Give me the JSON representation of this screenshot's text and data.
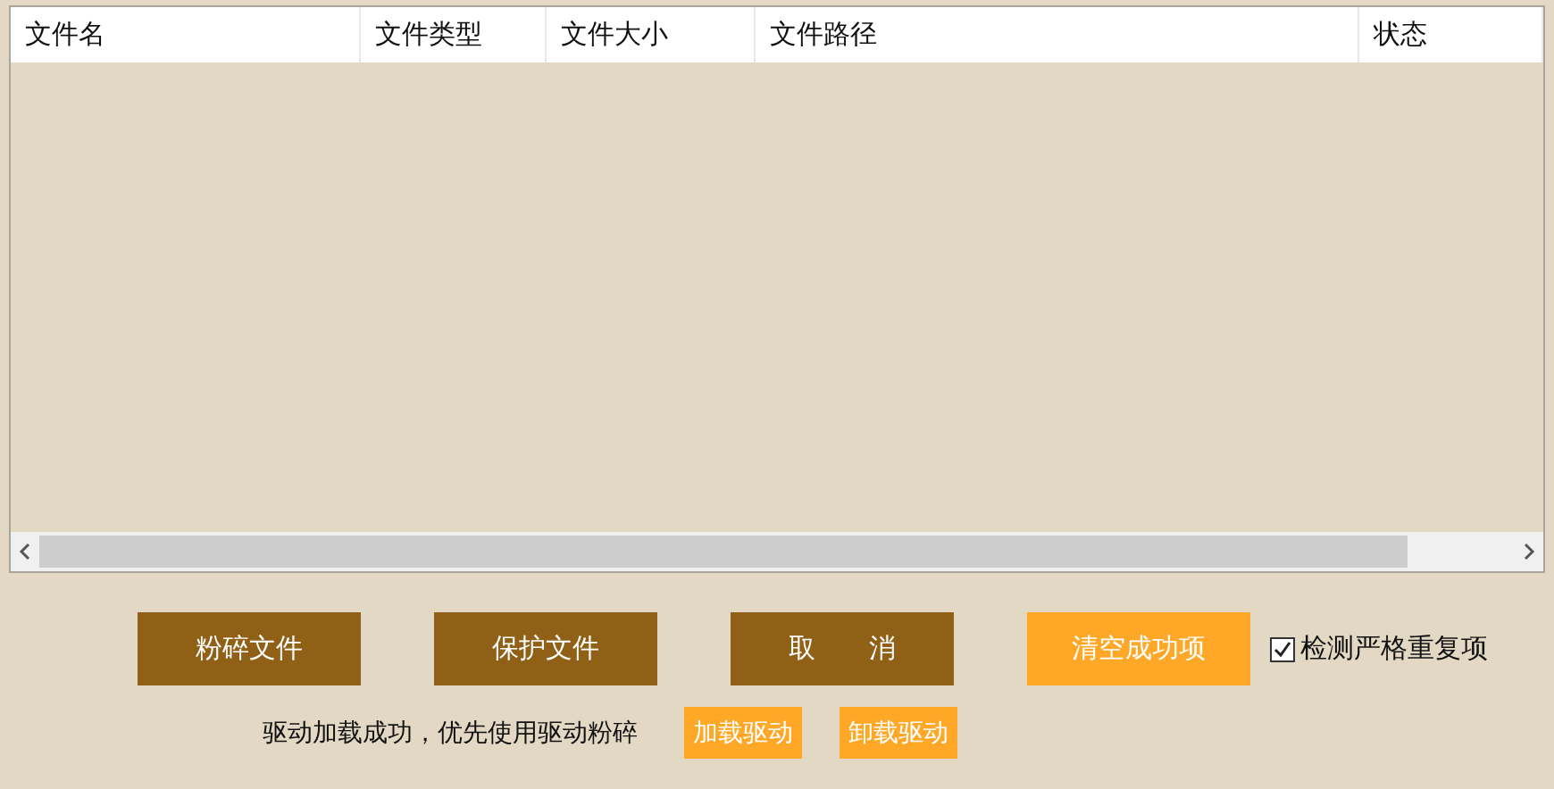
{
  "table": {
    "columns": [
      {
        "label": "文件名"
      },
      {
        "label": "文件类型"
      },
      {
        "label": "文件大小"
      },
      {
        "label": "文件路径"
      },
      {
        "label": "状态"
      }
    ]
  },
  "actions": [
    {
      "label": "粉碎文件",
      "kind": "dark"
    },
    {
      "label": "保护文件",
      "kind": "dark"
    },
    {
      "label": "取　　消",
      "kind": "dark"
    },
    {
      "label": "清空成功项",
      "kind": "orange"
    }
  ],
  "strict_check": {
    "label": "检测严格重复项",
    "checked": true
  },
  "driver": {
    "status": "驱动加载成功，优先使用驱动粉碎",
    "buttons": [
      {
        "label": "加载驱动"
      },
      {
        "label": "卸载驱动"
      }
    ]
  }
}
